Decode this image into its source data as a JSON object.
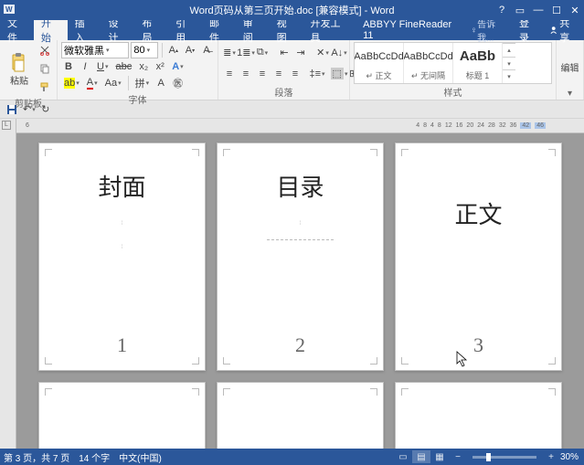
{
  "title": "Word页码从第三页开始.doc [兼容模式] - Word",
  "tabs": {
    "file": "文件",
    "home": "开始",
    "insert": "插入",
    "design": "设计",
    "layout": "布局",
    "references": "引用",
    "mailings": "邮件",
    "review": "审阅",
    "view": "视图",
    "developer": "开发工具",
    "abbyy": "ABBYY FineReader 11"
  },
  "tell_me": "告诉我...",
  "account": {
    "login": "登录",
    "share": "共享"
  },
  "clipboard": {
    "paste": "粘贴",
    "label": "剪贴板"
  },
  "font": {
    "name": "微软雅黑",
    "size": "80",
    "label": "字体"
  },
  "paragraph": {
    "label": "段落"
  },
  "styles": {
    "label": "样式",
    "items": [
      {
        "preview": "AaBbCcDd",
        "name": "↵ 正文"
      },
      {
        "preview": "AaBbCcDd",
        "name": "↵ 无间隔"
      },
      {
        "preview": "AaBb",
        "name": "标题 1"
      }
    ]
  },
  "editing": {
    "label": "编辑"
  },
  "ruler_ticks": [
    "4",
    "8",
    "4",
    "8",
    "12",
    "16",
    "20",
    "24",
    "28",
    "32",
    "36",
    "42",
    "46"
  ],
  "ruler_left": "6",
  "pages": [
    {
      "heading": "封面",
      "page_number": "1",
      "type": "cover"
    },
    {
      "heading": "目录",
      "page_number": "2",
      "type": "toc"
    },
    {
      "heading": "正文",
      "page_number": "3",
      "type": "body"
    }
  ],
  "status": {
    "page": "第 3 页，共 7 页",
    "words": "14 个字",
    "lang": "中文(中国)",
    "zoom": "30%"
  }
}
